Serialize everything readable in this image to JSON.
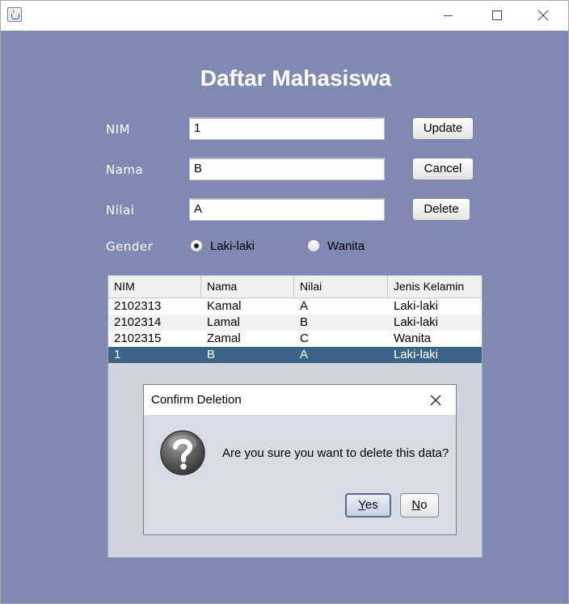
{
  "window": {
    "icon": "java-cup-icon",
    "controls": [
      "minimize-icon",
      "maximize-icon",
      "close-icon"
    ]
  },
  "heading": "Daftar Mahasiswa",
  "form": {
    "nim_label": "NIM",
    "nim_value": "1",
    "nama_label": "Nama",
    "nama_value": "B",
    "nilai_label": "Nilai",
    "nilai_value": "A",
    "gender_label": "Gender",
    "gender_options": [
      "Laki-laki",
      "Wanita"
    ],
    "gender_selected": "Laki-laki"
  },
  "buttons": {
    "update": "Update",
    "cancel": "Cancel",
    "delete": "Delete"
  },
  "table": {
    "columns": [
      "NIM",
      "Nama",
      "Nilai",
      "Jenis Kelamin"
    ],
    "rows": [
      [
        "2102313",
        "Kamal",
        "A",
        "Laki-laki"
      ],
      [
        "2102314",
        "Lamal",
        "B",
        "Laki-laki"
      ],
      [
        "2102315",
        "Zamal",
        "C",
        "Wanita"
      ],
      [
        "1",
        "B",
        "A",
        "Laki-laki"
      ]
    ],
    "selected_row_index": 3
  },
  "dialog": {
    "title": "Confirm Deletion",
    "icon": "question-icon",
    "message": "Are you sure you want to delete this data?",
    "yes_mnemonic": "Y",
    "yes_rest": "es",
    "no_mnemonic": "N",
    "no_rest": "o"
  },
  "colors": {
    "background": "#8089b2",
    "selected_row": "#3b6487",
    "dialog_body": "#d8dce6"
  }
}
